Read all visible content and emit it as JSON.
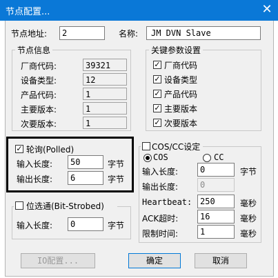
{
  "window": {
    "title": "节点配置..."
  },
  "node": {
    "address_label": "节点地址:",
    "address_value": "2",
    "name_label": "名称:",
    "name_value": "JM DVN Slave"
  },
  "node_info": {
    "legend": "节点信息",
    "rows": [
      {
        "label": "厂商代码:",
        "value": "39321"
      },
      {
        "label": "设备类型:",
        "value": "12"
      },
      {
        "label": "产品代码:",
        "value": "1"
      },
      {
        "label": "主要版本:",
        "value": "1"
      },
      {
        "label": "次要版本:",
        "value": "1"
      }
    ]
  },
  "key_params": {
    "legend": "关键参数设置",
    "items": [
      {
        "label": "厂商代码",
        "checked": true
      },
      {
        "label": "设备类型",
        "checked": true
      },
      {
        "label": "产品代码",
        "checked": true
      },
      {
        "label": "主要版本",
        "checked": true
      },
      {
        "label": "次要版本",
        "checked": true
      }
    ]
  },
  "polled": {
    "label": "轮询(Polled)",
    "checked": true,
    "input_label": "输入长度:",
    "input_value": "50",
    "output_label": "输出长度:",
    "output_value": "6",
    "unit": "字节"
  },
  "bitstrobed": {
    "label": "位选通(Bit-Strobed)",
    "checked": false,
    "input_label": "输入长度:",
    "input_value": "0",
    "unit": "字节"
  },
  "cos": {
    "label": "COS/CC设定",
    "checked": false,
    "radio_cos": "COS",
    "radio_cc": "CC",
    "input_label": "输入长度:",
    "input_value": "0",
    "output_label": "输出长度:",
    "output_value": "0",
    "unit": "字节",
    "heartbeat_label": "Heartbeat:",
    "heartbeat_value": "250",
    "ack_label": "ACK超时:",
    "ack_value": "16",
    "limit_label": "限制时间:",
    "limit_value": "1",
    "ms": "毫秒"
  },
  "buttons": {
    "io_config": "IO配置...",
    "ok": "确定",
    "cancel": "取消"
  }
}
